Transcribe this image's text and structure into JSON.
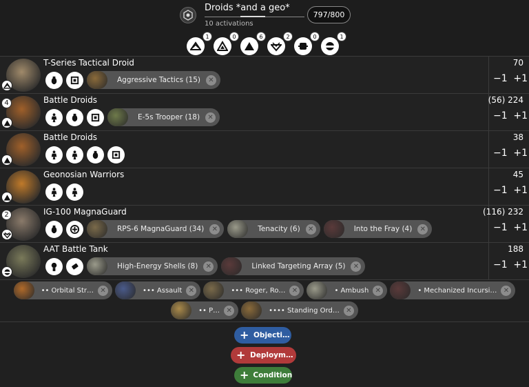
{
  "header": {
    "list_title": "Droids *and a geo*",
    "activations": "10 activations",
    "points": "797/800",
    "faction_icon": "separatist-hex-icon",
    "rank_counts": [
      {
        "rank": "commander",
        "count": "1"
      },
      {
        "rank": "operative",
        "count": "0"
      },
      {
        "rank": "corps",
        "count": "6"
      },
      {
        "rank": "special-forces",
        "count": "2"
      },
      {
        "rank": "support",
        "count": "0"
      },
      {
        "rank": "heavy",
        "count": "1"
      }
    ]
  },
  "units": [
    {
      "name": "T-Series Tactical Droid",
      "cost": "70",
      "count": "",
      "rank": "commander",
      "slots": [
        "grenade-slot-icon",
        "comms-slot-icon"
      ],
      "upgrades": [
        {
          "label": "Aggressive Tactics (15)"
        }
      ]
    },
    {
      "name": "Battle Droids",
      "cost": "(56) 224",
      "count": "4",
      "rank": "corps",
      "slots": [
        "trooper-slot-icon",
        "grenade-slot-icon",
        "comms-slot-icon"
      ],
      "upgrades": [
        {
          "label": "E-5s Trooper (18)"
        }
      ]
    },
    {
      "name": "Battle Droids",
      "cost": "38",
      "count": "",
      "rank": "corps",
      "slots": [
        "trooper-slot-icon",
        "trooper-slot-icon",
        "grenade-slot-icon",
        "comms-slot-icon"
      ],
      "upgrades": []
    },
    {
      "name": "Geonosian Warriors",
      "cost": "45",
      "count": "",
      "rank": "corps",
      "slots": [
        "trooper-slot-icon",
        "trooper-slot-icon"
      ],
      "upgrades": []
    },
    {
      "name": "IG-100 MagnaGuard",
      "cost": "(116) 232",
      "count": "2",
      "rank": "special-forces",
      "slots": [
        "grenade-slot-icon",
        "training-slot-icon"
      ],
      "upgrades": [
        {
          "label": "RPS-6 MagnaGuard (34)"
        },
        {
          "label": "Tenacity (6)"
        },
        {
          "label": "Into the Fray (4)"
        }
      ]
    },
    {
      "name": "AAT Battle Tank",
      "cost": "188",
      "count": "",
      "rank": "heavy",
      "slots": [
        "pilot-slot-icon",
        "hardpoint-slot-icon"
      ],
      "upgrades": [
        {
          "label": "High-Energy Shells (8)"
        },
        {
          "label": "Linked Targeting Array (5)"
        }
      ]
    }
  ],
  "controls": {
    "minus": "−1",
    "plus": "+1",
    "remove": "✕"
  },
  "command_cards": [
    [
      "•• Orbital Str…",
      "••• Assault",
      "••• Roger, Ro…",
      "• Ambush",
      "• Mechanized Incursi…"
    ],
    [
      "•• P…",
      "•••• Standing Ord…"
    ]
  ],
  "battle_buttons": [
    {
      "label": "Objecti…",
      "color": "#2f5da1"
    },
    {
      "label": "Deploym…",
      "color": "#b13a3a"
    },
    {
      "label": "Condition",
      "color": "#3e7d3a"
    }
  ]
}
